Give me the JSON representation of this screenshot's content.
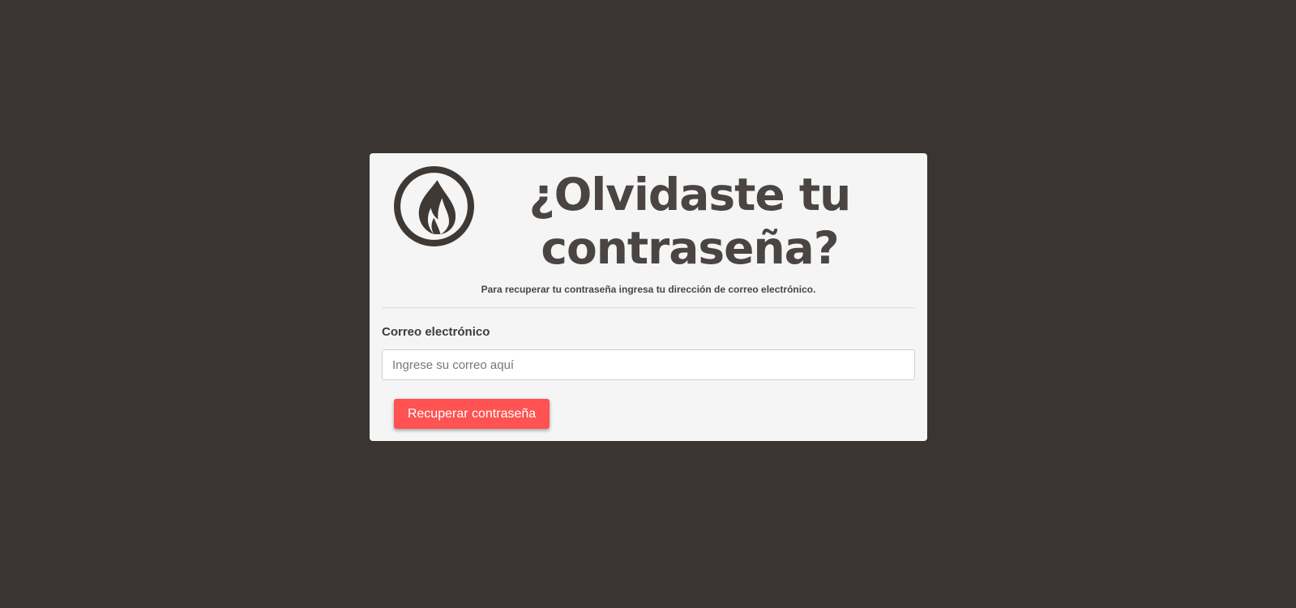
{
  "page": {
    "background_color": "#3a3532",
    "card_color": "#f5f5f5",
    "accent_color": "#ff5252",
    "text_color": "#4a4542"
  },
  "header": {
    "logo_icon": "flame-in-circle-icon",
    "title": "¿Olvidaste tu contraseña?",
    "subtitle": "Para recuperar tu contraseña ingresa tu dirección de correo electrónico."
  },
  "form": {
    "email_label": "Correo electrónico",
    "email_value": "",
    "email_placeholder": "Ingrese su correo aquí",
    "submit_label": "Recuperar contraseña"
  }
}
